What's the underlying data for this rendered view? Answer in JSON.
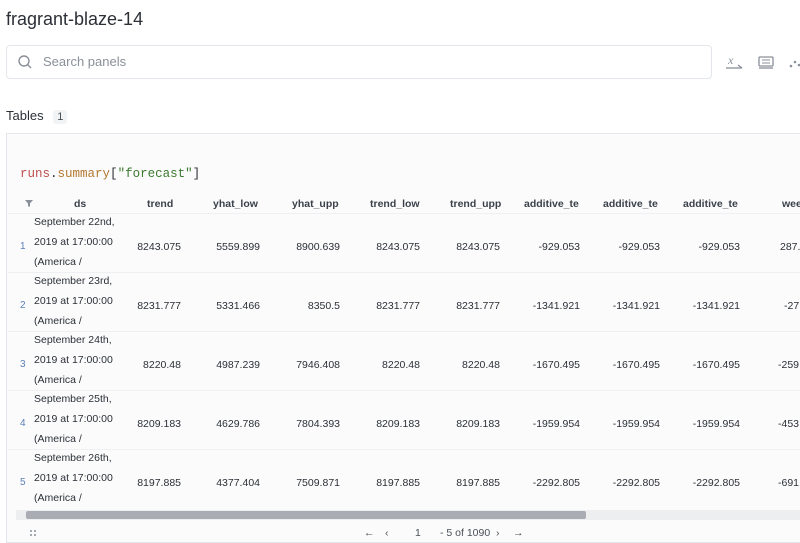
{
  "page": {
    "title": "fragrant-blaze-14"
  },
  "search": {
    "placeholder": "Search panels"
  },
  "section": {
    "label": "Tables",
    "count": "1"
  },
  "query": {
    "obj": "runs",
    "dot": ".",
    "attr": "summary",
    "key": "\"forecast\""
  },
  "columns": [
    "ds",
    "trend",
    "yhat_low",
    "yhat_upp",
    "trend_low",
    "trend_upp",
    "additive_te",
    "additive_te",
    "additive_te",
    "wee"
  ],
  "rows": [
    {
      "idx": "1",
      "ds": "September 22nd, 2019 at 17:00:00 (America /",
      "values": [
        "8243.075",
        "5559.899",
        "8900.639",
        "8243.075",
        "8243.075",
        "-929.053",
        "-929.053",
        "-929.053",
        "287."
      ]
    },
    {
      "idx": "2",
      "ds": "September 23rd, 2019 at 17:00:00 (America /",
      "values": [
        "8231.777",
        "5331.466",
        "8350.5",
        "8231.777",
        "8231.777",
        "-1341.921",
        "-1341.921",
        "-1341.921",
        "-27"
      ]
    },
    {
      "idx": "3",
      "ds": "September 24th, 2019 at 17:00:00 (America /",
      "values": [
        "8220.48",
        "4987.239",
        "7946.408",
        "8220.48",
        "8220.48",
        "-1670.495",
        "-1670.495",
        "-1670.495",
        "-259"
      ]
    },
    {
      "idx": "4",
      "ds": "September 25th, 2019 at 17:00:00 (America /",
      "values": [
        "8209.183",
        "4629.786",
        "7804.393",
        "8209.183",
        "8209.183",
        "-1959.954",
        "-1959.954",
        "-1959.954",
        "-453"
      ]
    },
    {
      "idx": "5",
      "ds": "September 26th, 2019 at 17:00:00 (America /",
      "values": [
        "8197.885",
        "4377.404",
        "7509.871",
        "8197.885",
        "8197.885",
        "-2292.805",
        "-2292.805",
        "-2292.805",
        "-691"
      ]
    }
  ],
  "pagination": {
    "prev_all": "←",
    "prev": "‹",
    "page": "1",
    "range": "- 5 of 1090",
    "next": "›",
    "next_all": "→"
  }
}
